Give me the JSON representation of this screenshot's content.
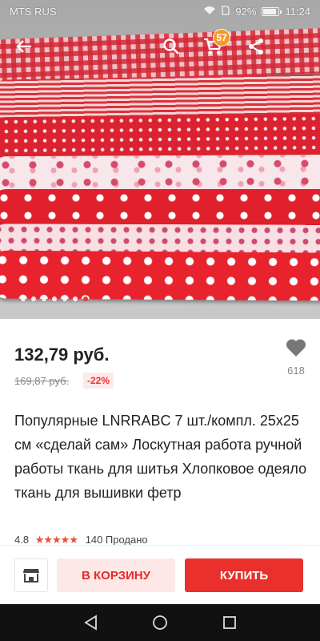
{
  "status_bar": {
    "carrier": "MTS RUS",
    "battery": "92%",
    "time": "11:24"
  },
  "header": {
    "cart_count": "57"
  },
  "gallery": {
    "image_count": 7,
    "active_index": 6
  },
  "product": {
    "price": "132,79 руб.",
    "old_price": "169,87 руб.",
    "discount": "-22%",
    "wishlist_count": "618",
    "title": "Популярные LNRRABC 7 шт./компл. 25x25 см «сделай сам» Лоскутная работа ручной работы ткань для шитья Хлопковое одеяло ткань для вышивки фетр",
    "rating": "4.8",
    "stars": "★★★★★",
    "orders": "140 Продано"
  },
  "actions": {
    "add_to_cart": "В КОРЗИНУ",
    "buy_now": "КУПИТЬ"
  },
  "colors": {
    "accent": "#e9302c",
    "badge": "#f29b2b",
    "cart_button_bg": "#fde7e7"
  }
}
